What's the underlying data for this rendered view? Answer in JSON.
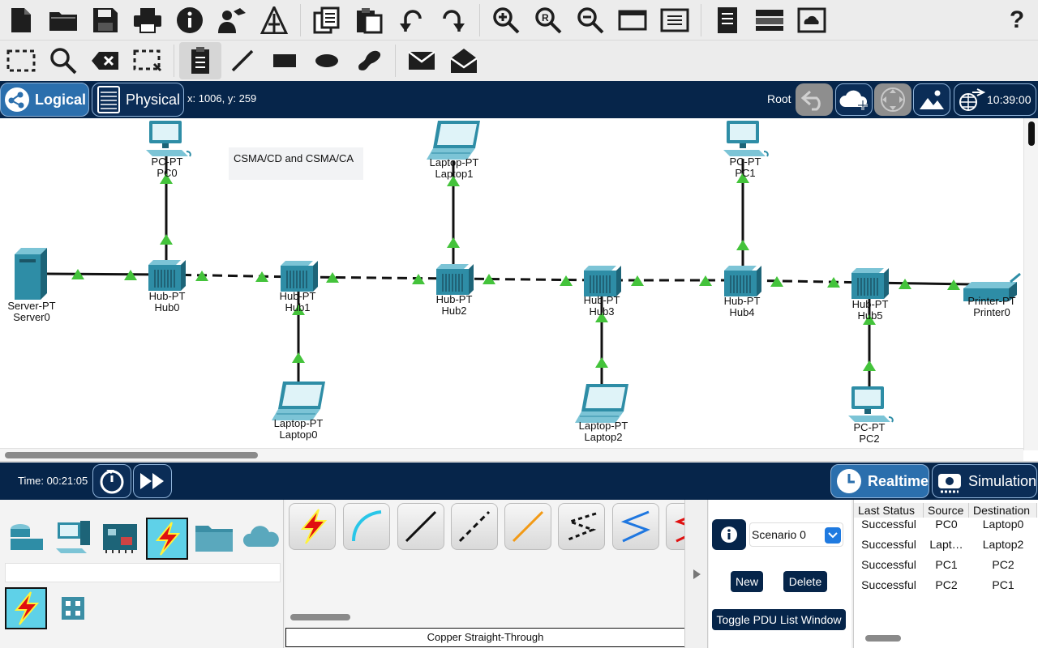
{
  "toolbar_main": {
    "buttons": [
      {
        "name": "new-file-icon"
      },
      {
        "name": "open-folder-icon"
      },
      {
        "name": "save-icon"
      },
      {
        "name": "print-icon"
      },
      {
        "name": "info-icon"
      },
      {
        "name": "activity-wizard-icon"
      },
      {
        "name": "custom-device-icon"
      },
      {
        "name": "copy-icon"
      },
      {
        "name": "paste-icon"
      },
      {
        "name": "undo-icon"
      },
      {
        "name": "redo-icon"
      },
      {
        "name": "zoom-in-icon"
      },
      {
        "name": "zoom-reset-icon"
      },
      {
        "name": "zoom-out-icon"
      },
      {
        "name": "window-icon"
      },
      {
        "name": "palette-icon"
      },
      {
        "name": "notes-icon"
      },
      {
        "name": "device-template-icon"
      },
      {
        "name": "cloud-viewer-icon"
      },
      {
        "name": "help-icon"
      }
    ],
    "help_label": "?"
  },
  "toolbar_secondary": {
    "buttons": [
      {
        "name": "select-icon"
      },
      {
        "name": "inspect-icon"
      },
      {
        "name": "delete-icon"
      },
      {
        "name": "resize-icon"
      },
      {
        "name": "place-note-icon"
      },
      {
        "name": "draw-line-icon"
      },
      {
        "name": "draw-rectangle-icon"
      },
      {
        "name": "draw-ellipse-icon"
      },
      {
        "name": "freeform-icon"
      },
      {
        "name": "add-simple-pdu-icon"
      },
      {
        "name": "add-complex-pdu-icon"
      }
    ]
  },
  "navbar": {
    "logical_label": "Logical",
    "physical_label": "Physical",
    "coords": "x: 1006, y: 259",
    "root_label": "Root",
    "clock": "10:39:00"
  },
  "workspace": {
    "note": "CSMA/CD and CSMA/CA",
    "devices": [
      {
        "id": "server0",
        "type": "Server-PT",
        "name": "Server0"
      },
      {
        "id": "hub0",
        "type": "Hub-PT",
        "name": "Hub0"
      },
      {
        "id": "hub1",
        "type": "Hub-PT",
        "name": "Hub1"
      },
      {
        "id": "hub2",
        "type": "Hub-PT",
        "name": "Hub2"
      },
      {
        "id": "hub3",
        "type": "Hub-PT",
        "name": "Hub3"
      },
      {
        "id": "hub4",
        "type": "Hub-PT",
        "name": "Hub4"
      },
      {
        "id": "hub5",
        "type": "Hub-PT",
        "name": "Hub5"
      },
      {
        "id": "printer0",
        "type": "Printer-PT",
        "name": "Printer0"
      },
      {
        "id": "pc0",
        "type": "PC-PT",
        "name": "PC0"
      },
      {
        "id": "pc1",
        "type": "PC-PT",
        "name": "PC1"
      },
      {
        "id": "pc2",
        "type": "PC-PT",
        "name": "PC2"
      },
      {
        "id": "laptop0",
        "type": "Laptop-PT",
        "name": "Laptop0"
      },
      {
        "id": "laptop1",
        "type": "Laptop-PT",
        "name": "Laptop1"
      },
      {
        "id": "laptop2",
        "type": "Laptop-PT",
        "name": "Laptop2"
      }
    ]
  },
  "timebar": {
    "time": "Time: 00:21:05",
    "realtime_label": "Realtime",
    "simulation_label": "Simulation"
  },
  "device_panel": {
    "categories": [
      "network-devices",
      "end-devices",
      "components",
      "connections",
      "miscellaneous",
      "multiuser"
    ],
    "selected_category": "connections"
  },
  "connections_panel": {
    "cables": [
      "automatic",
      "console",
      "copper-straight-through",
      "copper-cross-over",
      "fiber",
      "phone",
      "coaxial",
      "serial"
    ],
    "selected_name": "Copper Straight-Through"
  },
  "scenario_panel": {
    "scenario": "Scenario 0",
    "new_label": "New",
    "delete_label": "Delete",
    "toggle_label": "Toggle PDU List Window"
  },
  "pdu_list": {
    "headers": [
      "Last Status",
      "Source",
      "Destination"
    ],
    "rows": [
      [
        "Successful",
        "PC0",
        "Laptop0"
      ],
      [
        "Successful",
        "Lapt…",
        "Laptop2"
      ],
      [
        "Successful",
        "PC1",
        "PC2"
      ],
      [
        "Successful",
        "PC2",
        "PC1"
      ]
    ]
  },
  "colors": {
    "navy": "#06254a",
    "accent_blue": "#2b6fad",
    "link_green": "#44c33b",
    "device_teal": "#2e8da6"
  }
}
